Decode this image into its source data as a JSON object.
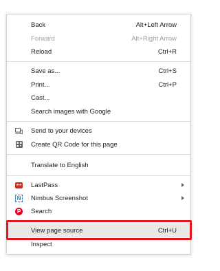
{
  "menu": {
    "back": {
      "label": "Back",
      "shortcut": "Alt+Left Arrow"
    },
    "forward": {
      "label": "Forward",
      "shortcut": "Alt+Right Arrow"
    },
    "reload": {
      "label": "Reload",
      "shortcut": "Ctrl+R"
    },
    "save_as": {
      "label": "Save as...",
      "shortcut": "Ctrl+S"
    },
    "print": {
      "label": "Print...",
      "shortcut": "Ctrl+P"
    },
    "cast": {
      "label": "Cast..."
    },
    "search_images": {
      "label": "Search images with Google"
    },
    "send_devices": {
      "label": "Send to your devices",
      "icon": "laptop-phone-icon"
    },
    "qr_code": {
      "label": "Create QR Code for this page",
      "icon": "qr-code-icon"
    },
    "translate": {
      "label": "Translate to English"
    },
    "lastpass": {
      "label": "LastPass",
      "icon": "lastpass-icon",
      "icon_text": "•••"
    },
    "nimbus": {
      "label": "Nimbus Screenshot",
      "icon": "nimbus-icon",
      "icon_text": "N"
    },
    "search": {
      "label": "Search",
      "icon": "pinterest-icon",
      "icon_text": "P"
    },
    "view_source": {
      "label": "View page source",
      "shortcut": "Ctrl+U"
    },
    "inspect": {
      "label": "Inspect"
    }
  },
  "colors": {
    "highlight_box": "#e8141c",
    "lastpass": "#d32d27",
    "nimbus": "#1e88c7",
    "pinterest": "#e60023"
  }
}
